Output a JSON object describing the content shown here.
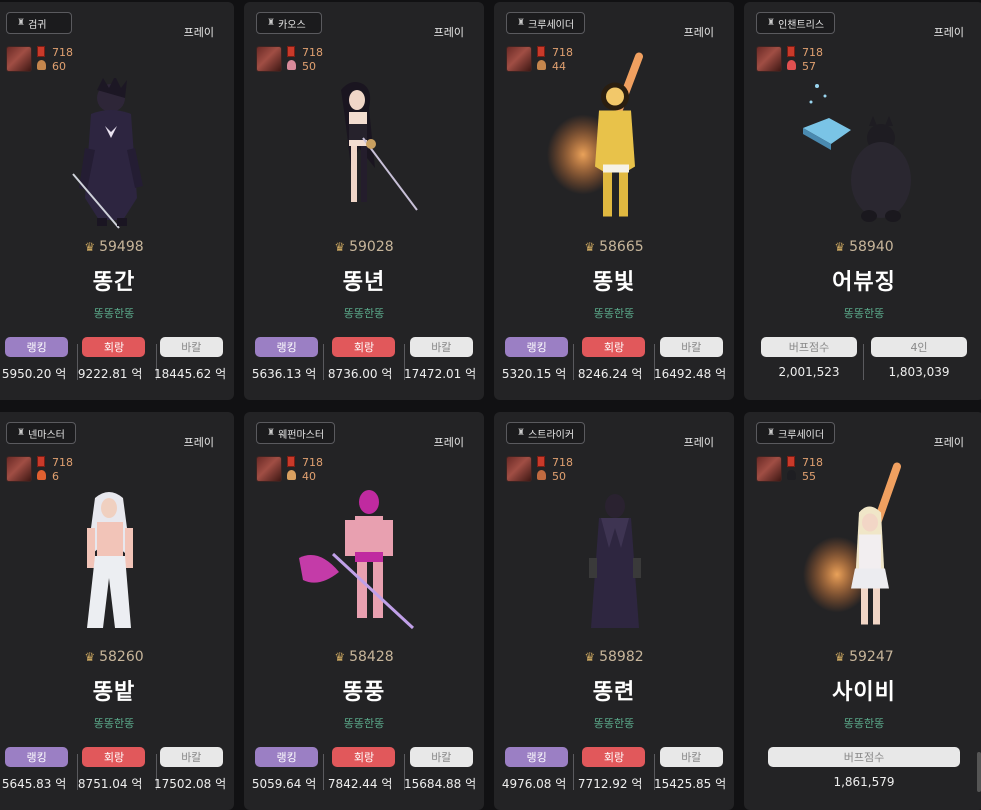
{
  "labels": {
    "play": "프레이",
    "rank": "랭킹",
    "loop": "회랑",
    "bakal": "바칼",
    "buff_score": "버프점수",
    "four": "4인",
    "eok": "억"
  },
  "cards": [
    {
      "job": "검귀",
      "level": "718",
      "sub": "60",
      "power": "59498",
      "name": "똥간",
      "guild": "똥똥한똥",
      "rank_val": "5950.20 억",
      "loop_val": "9222.81 억",
      "bakal_val": "18445.62 억"
    },
    {
      "job": "카오스",
      "level": "718",
      "sub": "50",
      "power": "59028",
      "name": "똥년",
      "guild": "똥똥한똥",
      "rank_val": "5636.13 억",
      "loop_val": "8736.00 억",
      "bakal_val": "17472.01 억"
    },
    {
      "job": "크루세이더",
      "level": "718",
      "sub": "44",
      "power": "58665",
      "name": "똥빛",
      "guild": "똥똥한똥",
      "rank_val": "5320.15 억",
      "loop_val": "8246.24 억",
      "bakal_val": "16492.48 억"
    },
    {
      "job": "인챈트리스",
      "level": "718",
      "sub": "57",
      "power": "58940",
      "name": "어뷰징",
      "guild": "똥똥한똥",
      "buff_val": "2,001,523",
      "four_val": "1,803,039"
    },
    {
      "job": "넨마스터",
      "level": "718",
      "sub": "6",
      "power": "58260",
      "name": "똥밭",
      "guild": "똥똥한똥",
      "rank_val": "5645.83 억",
      "loop_val": "8751.04 억",
      "bakal_val": "17502.08 억"
    },
    {
      "job": "웨펀마스터",
      "level": "718",
      "sub": "40",
      "power": "58428",
      "name": "똥풍",
      "guild": "똥똥한똥",
      "rank_val": "5059.64 억",
      "loop_val": "7842.44 억",
      "bakal_val": "15684.88 억"
    },
    {
      "job": "스트라이커",
      "level": "718",
      "sub": "50",
      "power": "58982",
      "name": "똥련",
      "guild": "똥똥한똥",
      "rank_val": "4976.08 억",
      "loop_val": "7712.92 억",
      "bakal_val": "15425.85 억"
    },
    {
      "job": "크루세이더",
      "level": "718",
      "sub": "55",
      "power": "59247",
      "name": "사이비",
      "guild": "똥똥한똥",
      "buff_val": "1,861,579"
    }
  ]
}
